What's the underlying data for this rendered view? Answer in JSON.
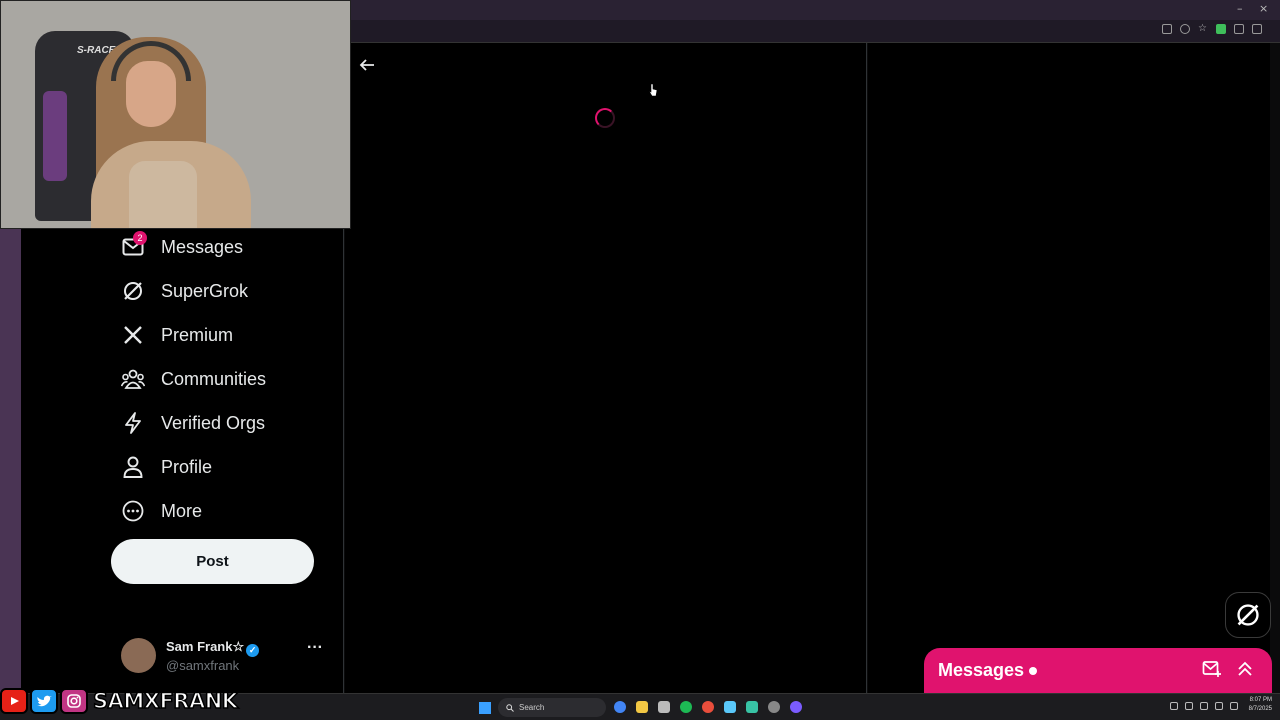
{
  "sidebar": {
    "items": [
      {
        "label": "Messages",
        "icon": "mail-icon",
        "badge": "2"
      },
      {
        "label": "SuperGrok",
        "icon": "grok-icon"
      },
      {
        "label": "Premium",
        "icon": "x-logo-icon"
      },
      {
        "label": "Communities",
        "icon": "communities-icon"
      },
      {
        "label": "Verified Orgs",
        "icon": "lightning-icon"
      },
      {
        "label": "Profile",
        "icon": "person-icon"
      },
      {
        "label": "More",
        "icon": "more-circle-icon"
      }
    ],
    "post_label": "Post",
    "account": {
      "name": "Sam Frank☆",
      "handle": "@samxfrank",
      "more": "···"
    }
  },
  "messages_drawer": {
    "title": "Messages"
  },
  "overlay": {
    "social_handle": "SAMXFRANK"
  },
  "taskbar": {
    "search_placeholder": "Search",
    "time": "8:07 PM",
    "date": "8/7/2025"
  },
  "colors": {
    "accent": "#e0136e",
    "verified": "#1d9bf0"
  }
}
